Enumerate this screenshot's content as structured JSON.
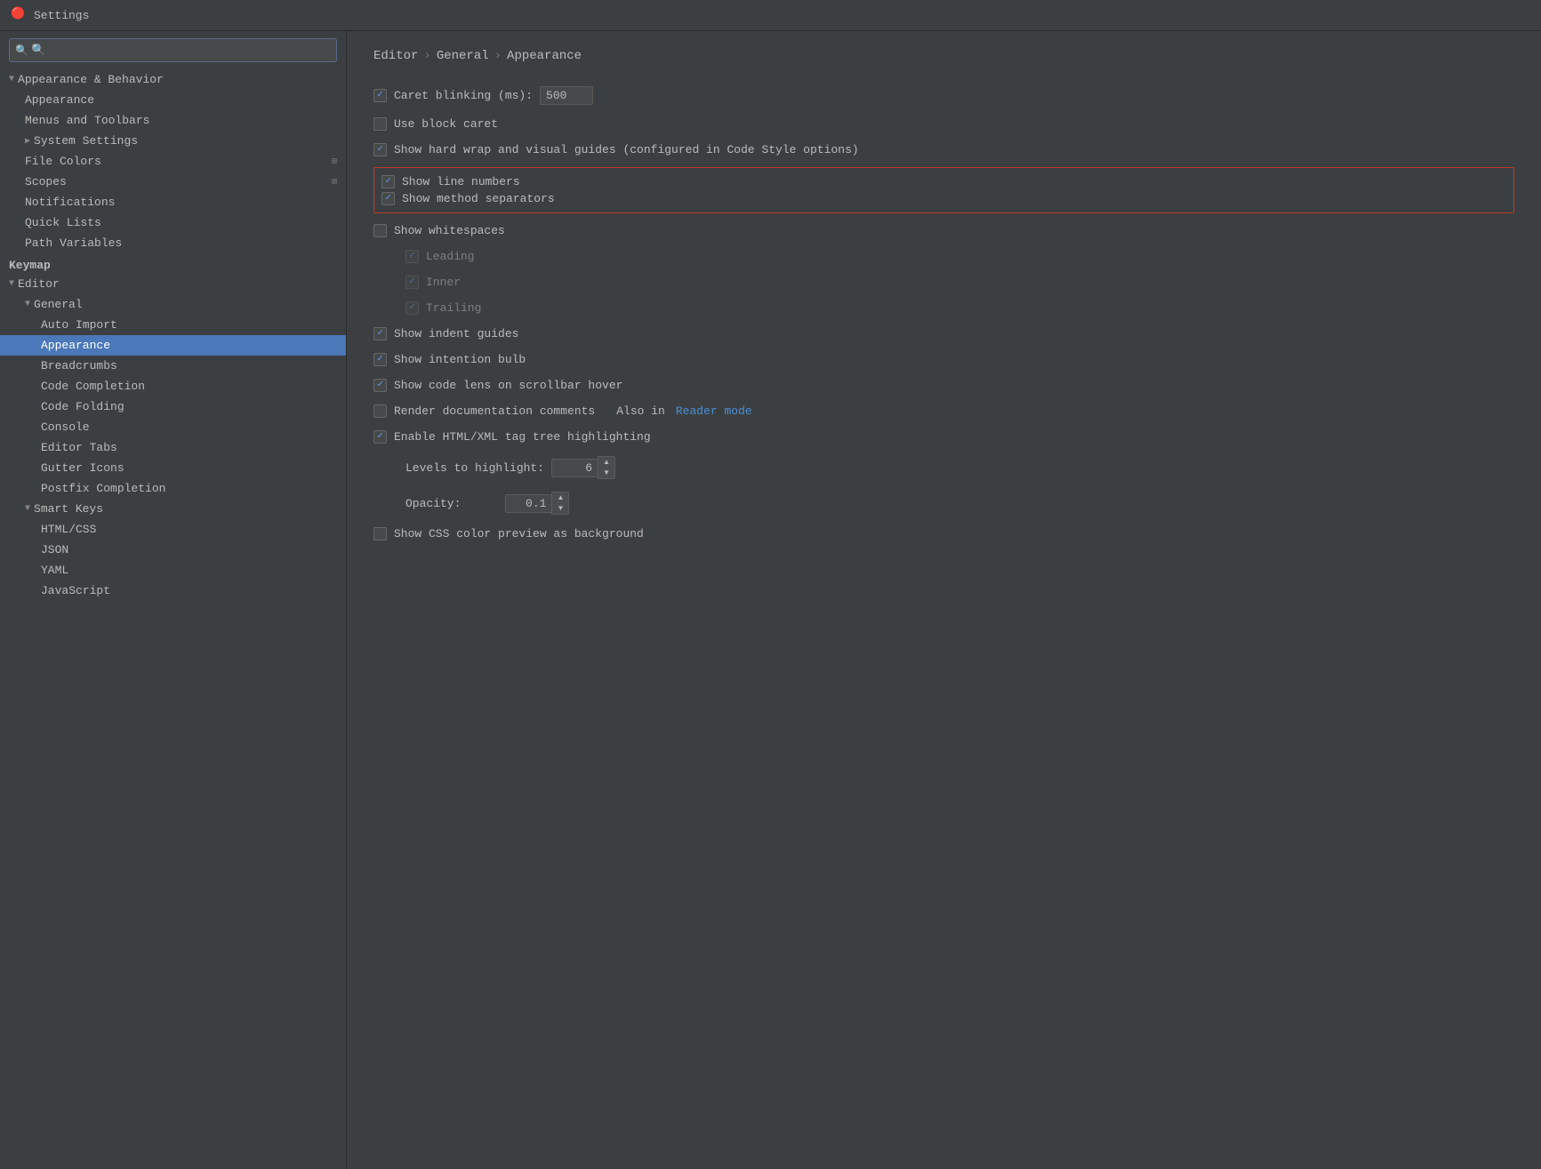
{
  "window": {
    "title": "Settings",
    "icon": "🔴"
  },
  "sidebar": {
    "search_placeholder": "🔍",
    "items": [
      {
        "id": "appearance-behavior",
        "label": "Appearance & Behavior",
        "level": 0,
        "type": "group",
        "expanded": true
      },
      {
        "id": "appearance",
        "label": "Appearance",
        "level": 1,
        "type": "item"
      },
      {
        "id": "menus-toolbars",
        "label": "Menus and Toolbars",
        "level": 1,
        "type": "item"
      },
      {
        "id": "system-settings",
        "label": "System Settings",
        "level": 1,
        "type": "group-item"
      },
      {
        "id": "file-colors",
        "label": "File Colors",
        "level": 1,
        "type": "item",
        "icon": "⚙"
      },
      {
        "id": "scopes",
        "label": "Scopes",
        "level": 1,
        "type": "item",
        "icon": "⚙"
      },
      {
        "id": "notifications",
        "label": "Notifications",
        "level": 1,
        "type": "item"
      },
      {
        "id": "quick-lists",
        "label": "Quick Lists",
        "level": 1,
        "type": "item"
      },
      {
        "id": "path-variables",
        "label": "Path Variables",
        "level": 1,
        "type": "item"
      },
      {
        "id": "keymap",
        "label": "Keymap",
        "level": 0,
        "type": "section"
      },
      {
        "id": "editor",
        "label": "Editor",
        "level": 0,
        "type": "group",
        "expanded": true
      },
      {
        "id": "general",
        "label": "General",
        "level": 1,
        "type": "group",
        "expanded": true
      },
      {
        "id": "auto-import",
        "label": "Auto Import",
        "level": 2,
        "type": "item"
      },
      {
        "id": "appearance-editor",
        "label": "Appearance",
        "level": 2,
        "type": "item",
        "active": true
      },
      {
        "id": "breadcrumbs",
        "label": "Breadcrumbs",
        "level": 2,
        "type": "item"
      },
      {
        "id": "code-completion",
        "label": "Code Completion",
        "level": 2,
        "type": "item"
      },
      {
        "id": "code-folding",
        "label": "Code Folding",
        "level": 2,
        "type": "item"
      },
      {
        "id": "console",
        "label": "Console",
        "level": 2,
        "type": "item"
      },
      {
        "id": "editor-tabs",
        "label": "Editor Tabs",
        "level": 2,
        "type": "item"
      },
      {
        "id": "gutter-icons",
        "label": "Gutter Icons",
        "level": 2,
        "type": "item"
      },
      {
        "id": "postfix-completion",
        "label": "Postfix Completion",
        "level": 2,
        "type": "item"
      },
      {
        "id": "smart-keys",
        "label": "Smart Keys",
        "level": 1,
        "type": "group",
        "expanded": true
      },
      {
        "id": "html-css",
        "label": "HTML/CSS",
        "level": 2,
        "type": "item"
      },
      {
        "id": "json",
        "label": "JSON",
        "level": 2,
        "type": "item"
      },
      {
        "id": "yaml",
        "label": "YAML",
        "level": 2,
        "type": "item"
      },
      {
        "id": "javascript",
        "label": "JavaScript",
        "level": 2,
        "type": "item"
      }
    ]
  },
  "content": {
    "breadcrumb": [
      "Editor",
      "General",
      "Appearance"
    ],
    "rows": [
      {
        "id": "caret-blinking",
        "type": "checkbox-input",
        "checked": true,
        "label": "Caret blinking (ms):",
        "input_value": "500",
        "indent": 0
      },
      {
        "id": "use-block-caret",
        "type": "checkbox",
        "checked": false,
        "label": "Use block caret",
        "indent": 0
      },
      {
        "id": "show-hard-wrap",
        "type": "checkbox",
        "checked": true,
        "label": "Show hard wrap and visual guides (configured in Code Style options)",
        "indent": 0
      },
      {
        "id": "show-line-numbers",
        "type": "checkbox",
        "checked": true,
        "label": "Show line numbers",
        "indent": 0,
        "highlighted": true
      },
      {
        "id": "show-method-separators",
        "type": "checkbox",
        "checked": true,
        "label": "Show method separators",
        "indent": 0,
        "highlighted": true
      },
      {
        "id": "show-whitespaces",
        "type": "checkbox",
        "checked": false,
        "label": "Show whitespaces",
        "indent": 0
      },
      {
        "id": "leading",
        "type": "checkbox",
        "checked": true,
        "label": "Leading",
        "indent": 1,
        "dim": true
      },
      {
        "id": "inner",
        "type": "checkbox",
        "checked": true,
        "label": "Inner",
        "indent": 1,
        "dim": true
      },
      {
        "id": "trailing",
        "type": "checkbox",
        "checked": true,
        "label": "Trailing",
        "indent": 1,
        "dim": true
      },
      {
        "id": "show-indent-guides",
        "type": "checkbox",
        "checked": true,
        "label": "Show indent guides",
        "indent": 0
      },
      {
        "id": "show-intention-bulb",
        "type": "checkbox",
        "checked": true,
        "label": "Show intention bulb",
        "indent": 0
      },
      {
        "id": "show-code-lens",
        "type": "checkbox",
        "checked": true,
        "label": "Show code lens on scrollbar hover",
        "indent": 0
      },
      {
        "id": "render-documentation",
        "type": "checkbox-link",
        "checked": false,
        "label": "Render documentation comments",
        "link_text": "Reader mode",
        "link_prefix": "Also in",
        "indent": 0
      },
      {
        "id": "enable-html-xml",
        "type": "checkbox",
        "checked": true,
        "label": "Enable HTML/XML tag tree highlighting",
        "indent": 0
      },
      {
        "id": "levels-to-highlight",
        "type": "label-spinner",
        "label": "Levels to highlight:",
        "value": "6",
        "indent": 1
      },
      {
        "id": "opacity",
        "type": "label-spinner",
        "label": "Opacity:",
        "value": "0.1",
        "indent": 1
      },
      {
        "id": "show-css-color",
        "type": "checkbox",
        "checked": false,
        "label": "Show CSS color preview as background",
        "indent": 0
      }
    ],
    "spinner_up": "▲",
    "spinner_down": "▼"
  }
}
